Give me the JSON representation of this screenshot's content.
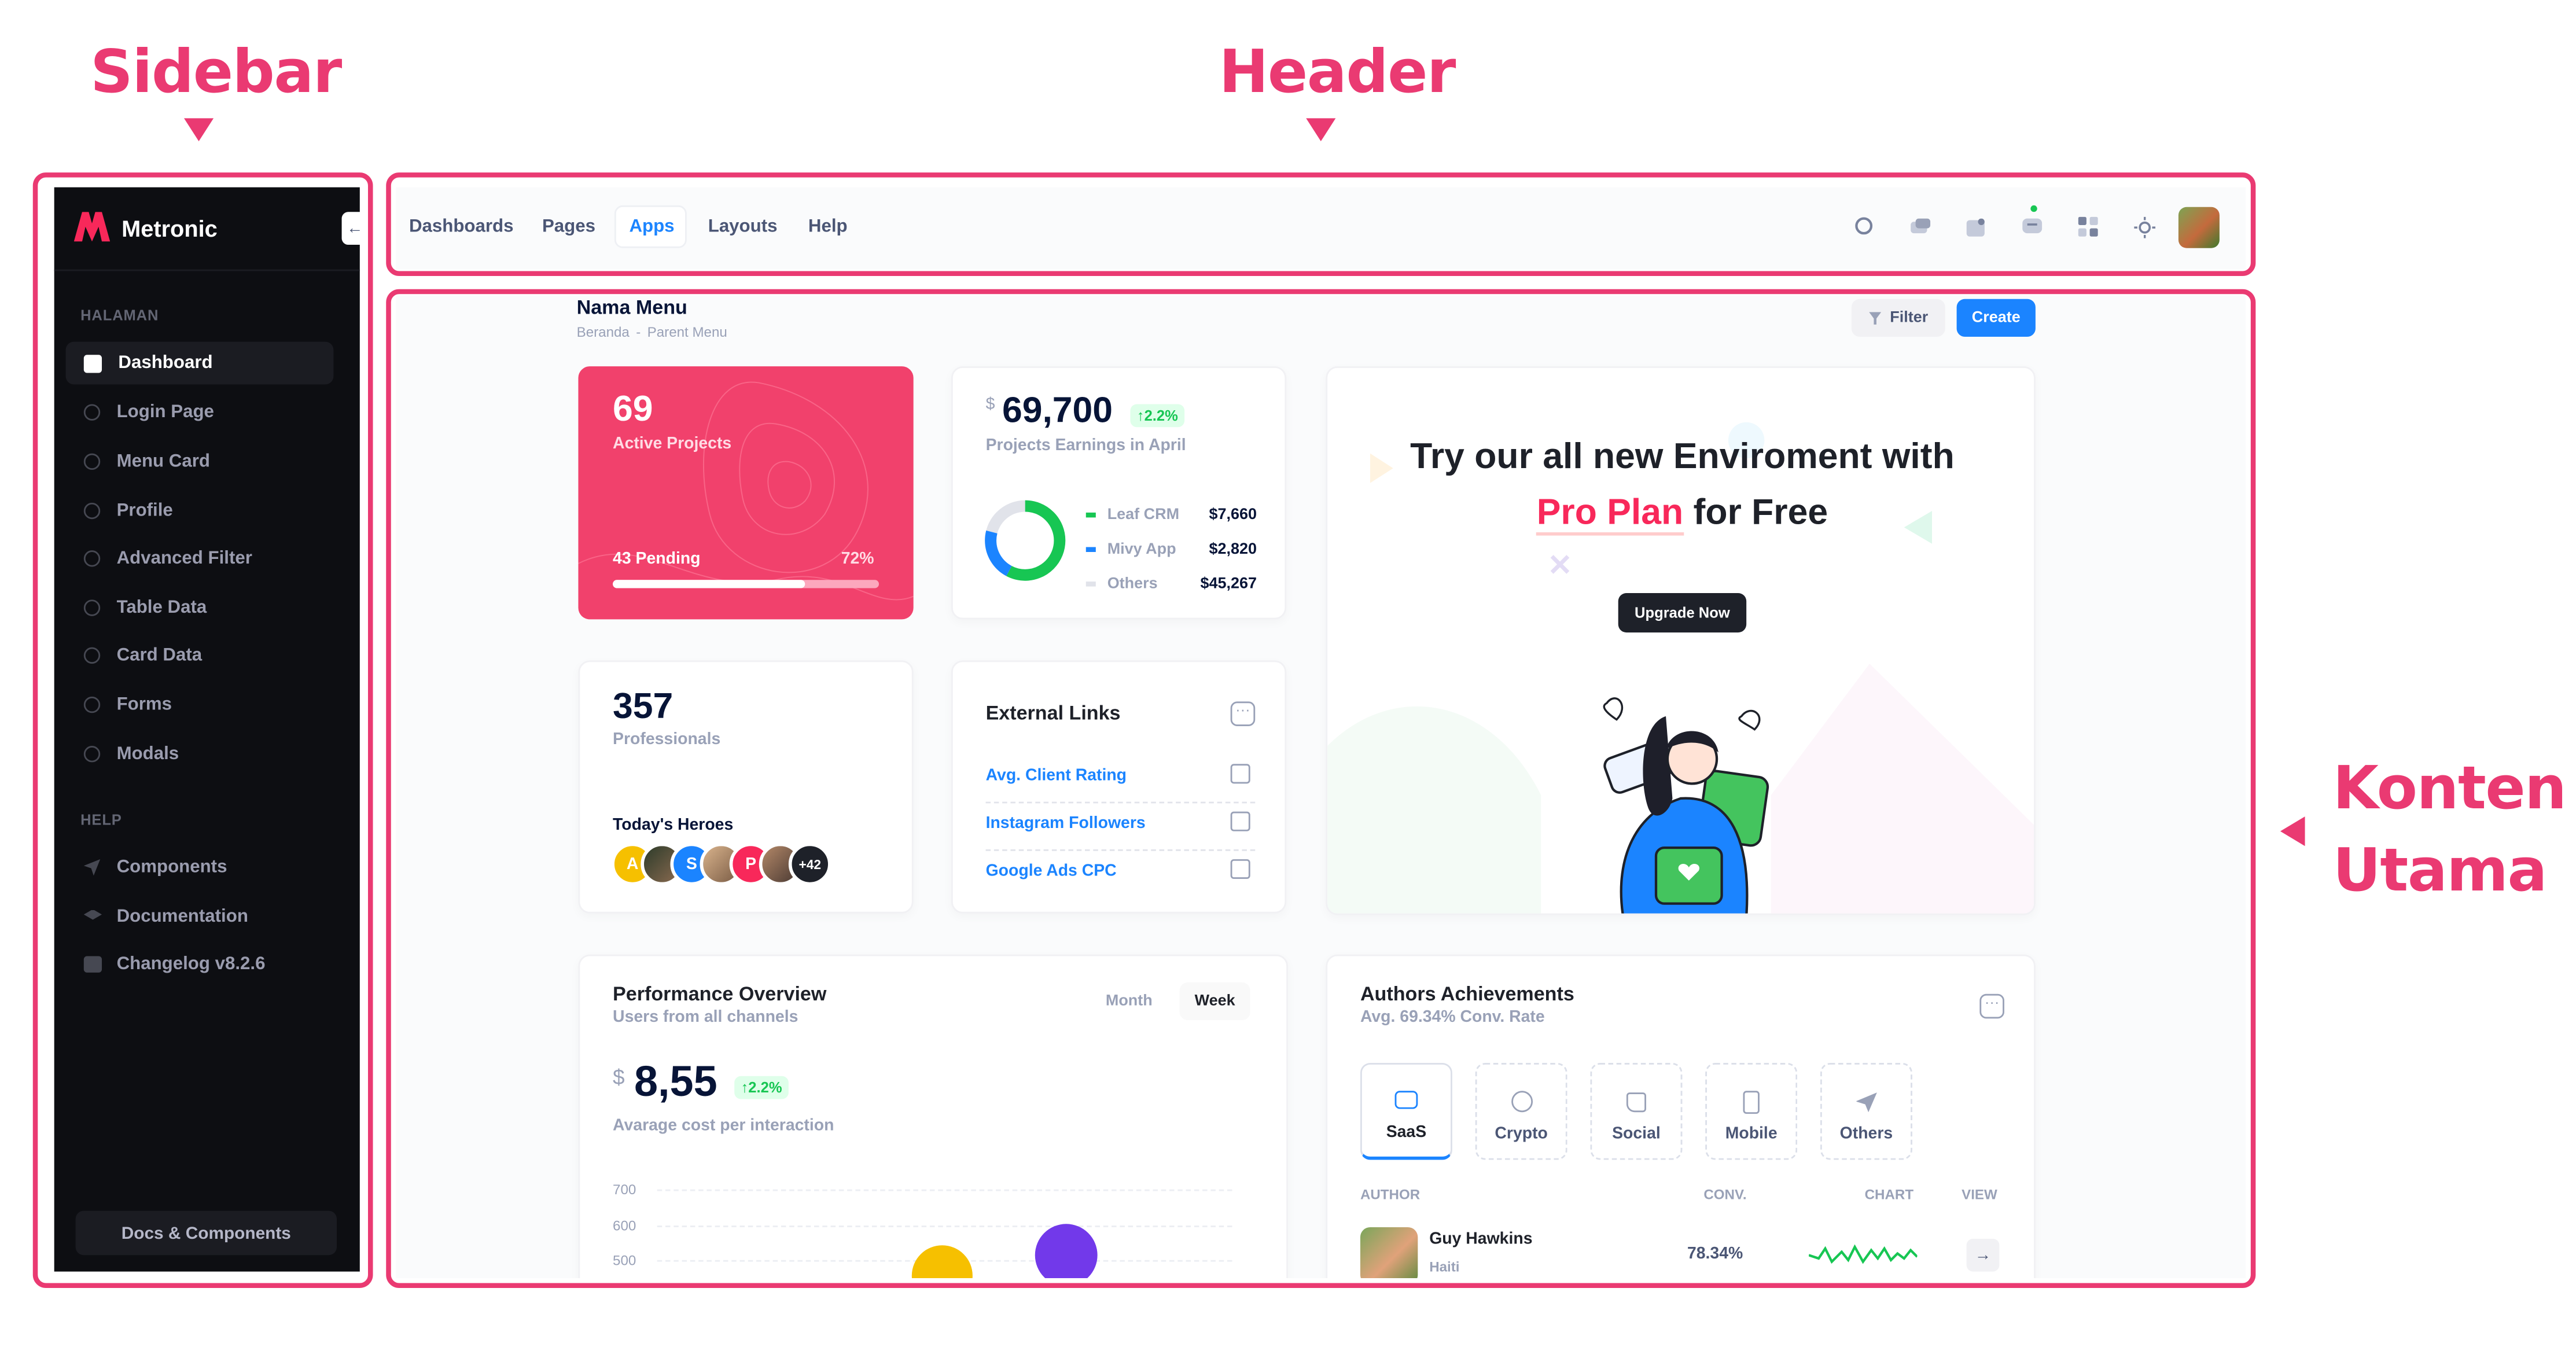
{
  "annotations": {
    "sidebar": "Sidebar",
    "header": "Header",
    "konten_line1": "Konten",
    "konten_line2": "Utama"
  },
  "colors": {
    "accent": "#ea3a72",
    "primary": "#1b84ff",
    "success": "#17c653",
    "danger": "#f8285a",
    "dark": "#1e2129"
  },
  "sidebar": {
    "brand": "Metronic",
    "section_main": "HALAMAN",
    "items": [
      {
        "label": "Dashboard",
        "icon": "dashboard-icon"
      },
      {
        "label": "Login Page",
        "icon": "bullet-icon"
      },
      {
        "label": "Menu Card",
        "icon": "bullet-icon"
      },
      {
        "label": "Profile",
        "icon": "bullet-icon"
      },
      {
        "label": "Advanced Filter",
        "icon": "bullet-icon"
      },
      {
        "label": "Table Data",
        "icon": "bullet-icon"
      },
      {
        "label": "Card Data",
        "icon": "bullet-icon"
      },
      {
        "label": "Forms",
        "icon": "bullet-icon"
      },
      {
        "label": "Modals",
        "icon": "bullet-icon"
      }
    ],
    "section_help": "HELP",
    "help_items": [
      {
        "label": "Components",
        "icon": "rocket-icon"
      },
      {
        "label": "Documentation",
        "icon": "layers-icon"
      },
      {
        "label": "Changelog v8.2.6",
        "icon": "code-icon"
      }
    ],
    "footer_button": "Docs & Components"
  },
  "header": {
    "nav": [
      "Dashboards",
      "Pages",
      "Apps",
      "Layouts",
      "Help"
    ],
    "active_nav": "Apps",
    "icons": [
      "search-icon",
      "chat-icon",
      "notification-icon",
      "messages-icon",
      "apps-grid-icon",
      "theme-sun-icon",
      "user-avatar"
    ]
  },
  "page": {
    "title": "Nama Menu",
    "breadcrumb_home": "Beranda",
    "breadcrumb_sep": "-",
    "breadcrumb_parent": "Parent Menu",
    "filter_button": "Filter",
    "create_button": "Create"
  },
  "projects_card": {
    "value": "69",
    "label": "Active Projects",
    "pending": "43 Pending",
    "percent": "72%",
    "progress": 0.72
  },
  "earnings_card": {
    "currency": "$",
    "value": "69,700",
    "change": "2.2%",
    "label": "Projects Earnings in April",
    "legend": [
      {
        "name": "Leaf CRM",
        "value": "$7,660",
        "color": "#17c653"
      },
      {
        "name": "Mivy App",
        "value": "$2,820",
        "color": "#1b84ff"
      },
      {
        "name": "Others",
        "value": "$45,267",
        "color": "#e1e3ea"
      }
    ]
  },
  "promo_card": {
    "line1": "Try our all new Enviroment with",
    "highlight": "Pro Plan",
    "line2_rest": "for Free",
    "button": "Upgrade Now"
  },
  "professionals_card": {
    "value": "357",
    "label": "Professionals",
    "heroes_title": "Today's Heroes",
    "avatars": [
      "A",
      "",
      "S",
      "",
      "P",
      ""
    ],
    "more": "+42"
  },
  "links_card": {
    "title": "External Links",
    "links": [
      "Avg. Client Rating",
      "Instagram Followers",
      "Google Ads CPC"
    ]
  },
  "performance_card": {
    "title": "Performance Overview",
    "subtitle": "Users from all channels",
    "tab_month": "Month",
    "tab_week": "Week",
    "currency": "$",
    "value": "8,55",
    "change": "2.2%",
    "caption": "Avarage cost per interaction",
    "y_ticks": [
      "700",
      "600",
      "500"
    ]
  },
  "authors_card": {
    "title": "Authors Achievements",
    "subtitle": "Avg. 69.34% Conv. Rate",
    "tabs": [
      "SaaS",
      "Crypto",
      "Social",
      "Mobile",
      "Others"
    ],
    "col_author": "AUTHOR",
    "col_conv": "CONV.",
    "col_chart": "CHART",
    "col_view": "VIEW",
    "row": {
      "name": "Guy Hawkins",
      "country": "Haiti",
      "conv": "78.34%"
    }
  }
}
